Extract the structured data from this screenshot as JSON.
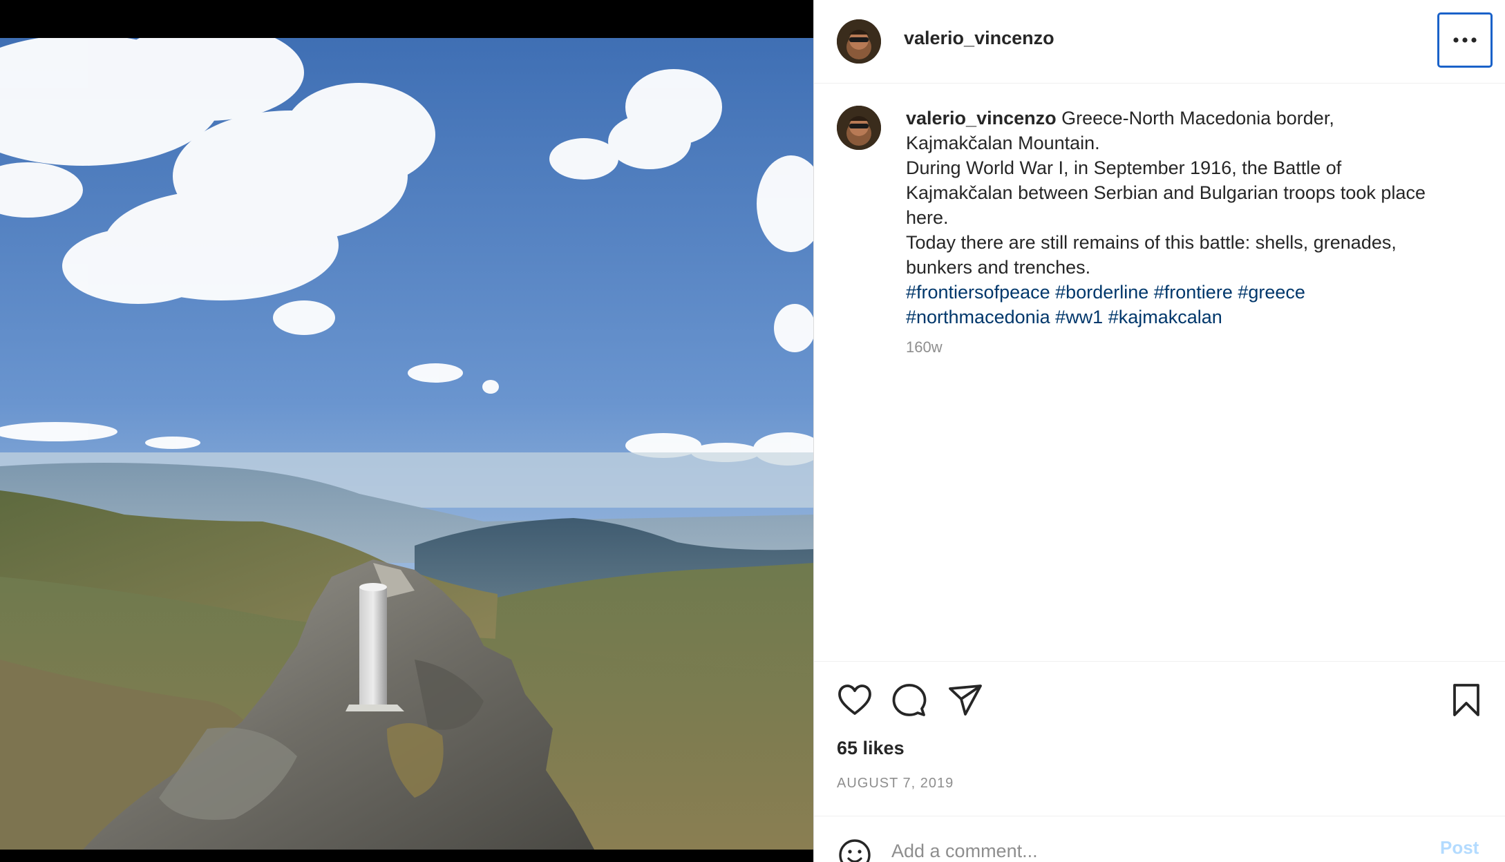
{
  "post": {
    "username": "valerio_vincenzo",
    "caption_lines": [
      "Greece-North Macedonia border,",
      "Kajmakčalan Mountain.",
      "During World War I, in September 1916, the Battle of",
      "Kajmakčalan between Serbian and Bulgarian troops took place",
      "here.",
      "Today there are still remains of this battle: shells, grenades,",
      "bunkers and trenches."
    ],
    "hashtags_line1": [
      "#frontiersofpeace",
      "#borderline",
      "#frontiere",
      "#greece"
    ],
    "hashtags_line2": [
      "#northmacedonia",
      "#ww1",
      "#kajmakcalan"
    ],
    "time_ago": "160w",
    "likes": "65 likes",
    "date": "AUGUST 7, 2019"
  },
  "comment": {
    "placeholder": "Add a comment...",
    "post_label": "Post"
  },
  "icons": {
    "more": "more-options-icon",
    "like": "heart-icon",
    "comment": "comment-bubble-icon",
    "share": "paper-plane-icon",
    "save": "bookmark-icon",
    "emoji": "smiley-icon"
  },
  "colors": {
    "hashtag": "#00376b",
    "focus_ring": "#1a62c9",
    "post_disabled": "#b3dbff",
    "secondary_text": "#8e8e8e"
  }
}
